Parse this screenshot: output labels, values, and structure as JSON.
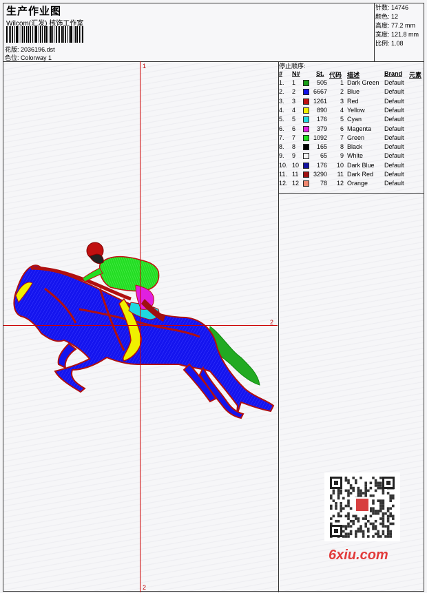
{
  "header": {
    "title": "生产作业图",
    "subtitle": "Wilcom(汇发) 核饰工作室",
    "file_label": "花版:",
    "file_value": "2036196.dst",
    "colorway_label": "色位:",
    "colorway_value": "Colorway 1"
  },
  "stats": {
    "stitches": "针数: 14746",
    "colors": "颜色: 12",
    "height": "高度: 77.2 mm",
    "width": "宽度: 121.8 mm",
    "scale": "比例: 1.08"
  },
  "design": {
    "axis_top": "1",
    "axis_bottom": "2",
    "axis_right": "2"
  },
  "stop_sequence": {
    "title": "停止顺序:",
    "headers": {
      "num": "#",
      "n": "N#",
      "st": "St.",
      "code": "代码",
      "desc": "描述",
      "brand": "Brand",
      "element": "元素"
    },
    "rows": [
      {
        "num": "1.",
        "n": "1",
        "color": "#18a018",
        "st": "505",
        "code": "1",
        "desc": "Dark Green",
        "brand": "Default"
      },
      {
        "num": "2.",
        "n": "2",
        "color": "#1010e8",
        "st": "6667",
        "code": "2",
        "desc": "Blue",
        "brand": "Default"
      },
      {
        "num": "3.",
        "n": "3",
        "color": "#c01010",
        "st": "1261",
        "code": "3",
        "desc": "Red",
        "brand": "Default"
      },
      {
        "num": "4.",
        "n": "4",
        "color": "#f0f000",
        "st": "890",
        "code": "4",
        "desc": "Yellow",
        "brand": "Default"
      },
      {
        "num": "5.",
        "n": "5",
        "color": "#20d8e0",
        "st": "176",
        "code": "5",
        "desc": "Cyan",
        "brand": "Default"
      },
      {
        "num": "6.",
        "n": "6",
        "color": "#e020e0",
        "st": "379",
        "code": "6",
        "desc": "Magenta",
        "brand": "Default"
      },
      {
        "num": "7.",
        "n": "7",
        "color": "#20e020",
        "st": "1092",
        "code": "7",
        "desc": "Green",
        "brand": "Default"
      },
      {
        "num": "8.",
        "n": "8",
        "color": "#000000",
        "st": "165",
        "code": "8",
        "desc": "Black",
        "brand": "Default"
      },
      {
        "num": "9.",
        "n": "9",
        "color": "#f4f4f4",
        "st": "65",
        "code": "9",
        "desc": "White",
        "brand": "Default"
      },
      {
        "num": "10.",
        "n": "10",
        "color": "#1010a0",
        "st": "176",
        "code": "10",
        "desc": "Dark Blue",
        "brand": "Default"
      },
      {
        "num": "11.",
        "n": "11",
        "color": "#a01010",
        "st": "3290",
        "code": "11",
        "desc": "Dark Red",
        "brand": "Default"
      },
      {
        "num": "12.",
        "n": "12",
        "color": "#f08870",
        "st": "78",
        "code": "12",
        "desc": "Orange",
        "brand": "Default"
      }
    ]
  },
  "watermark": "6xiu.com"
}
